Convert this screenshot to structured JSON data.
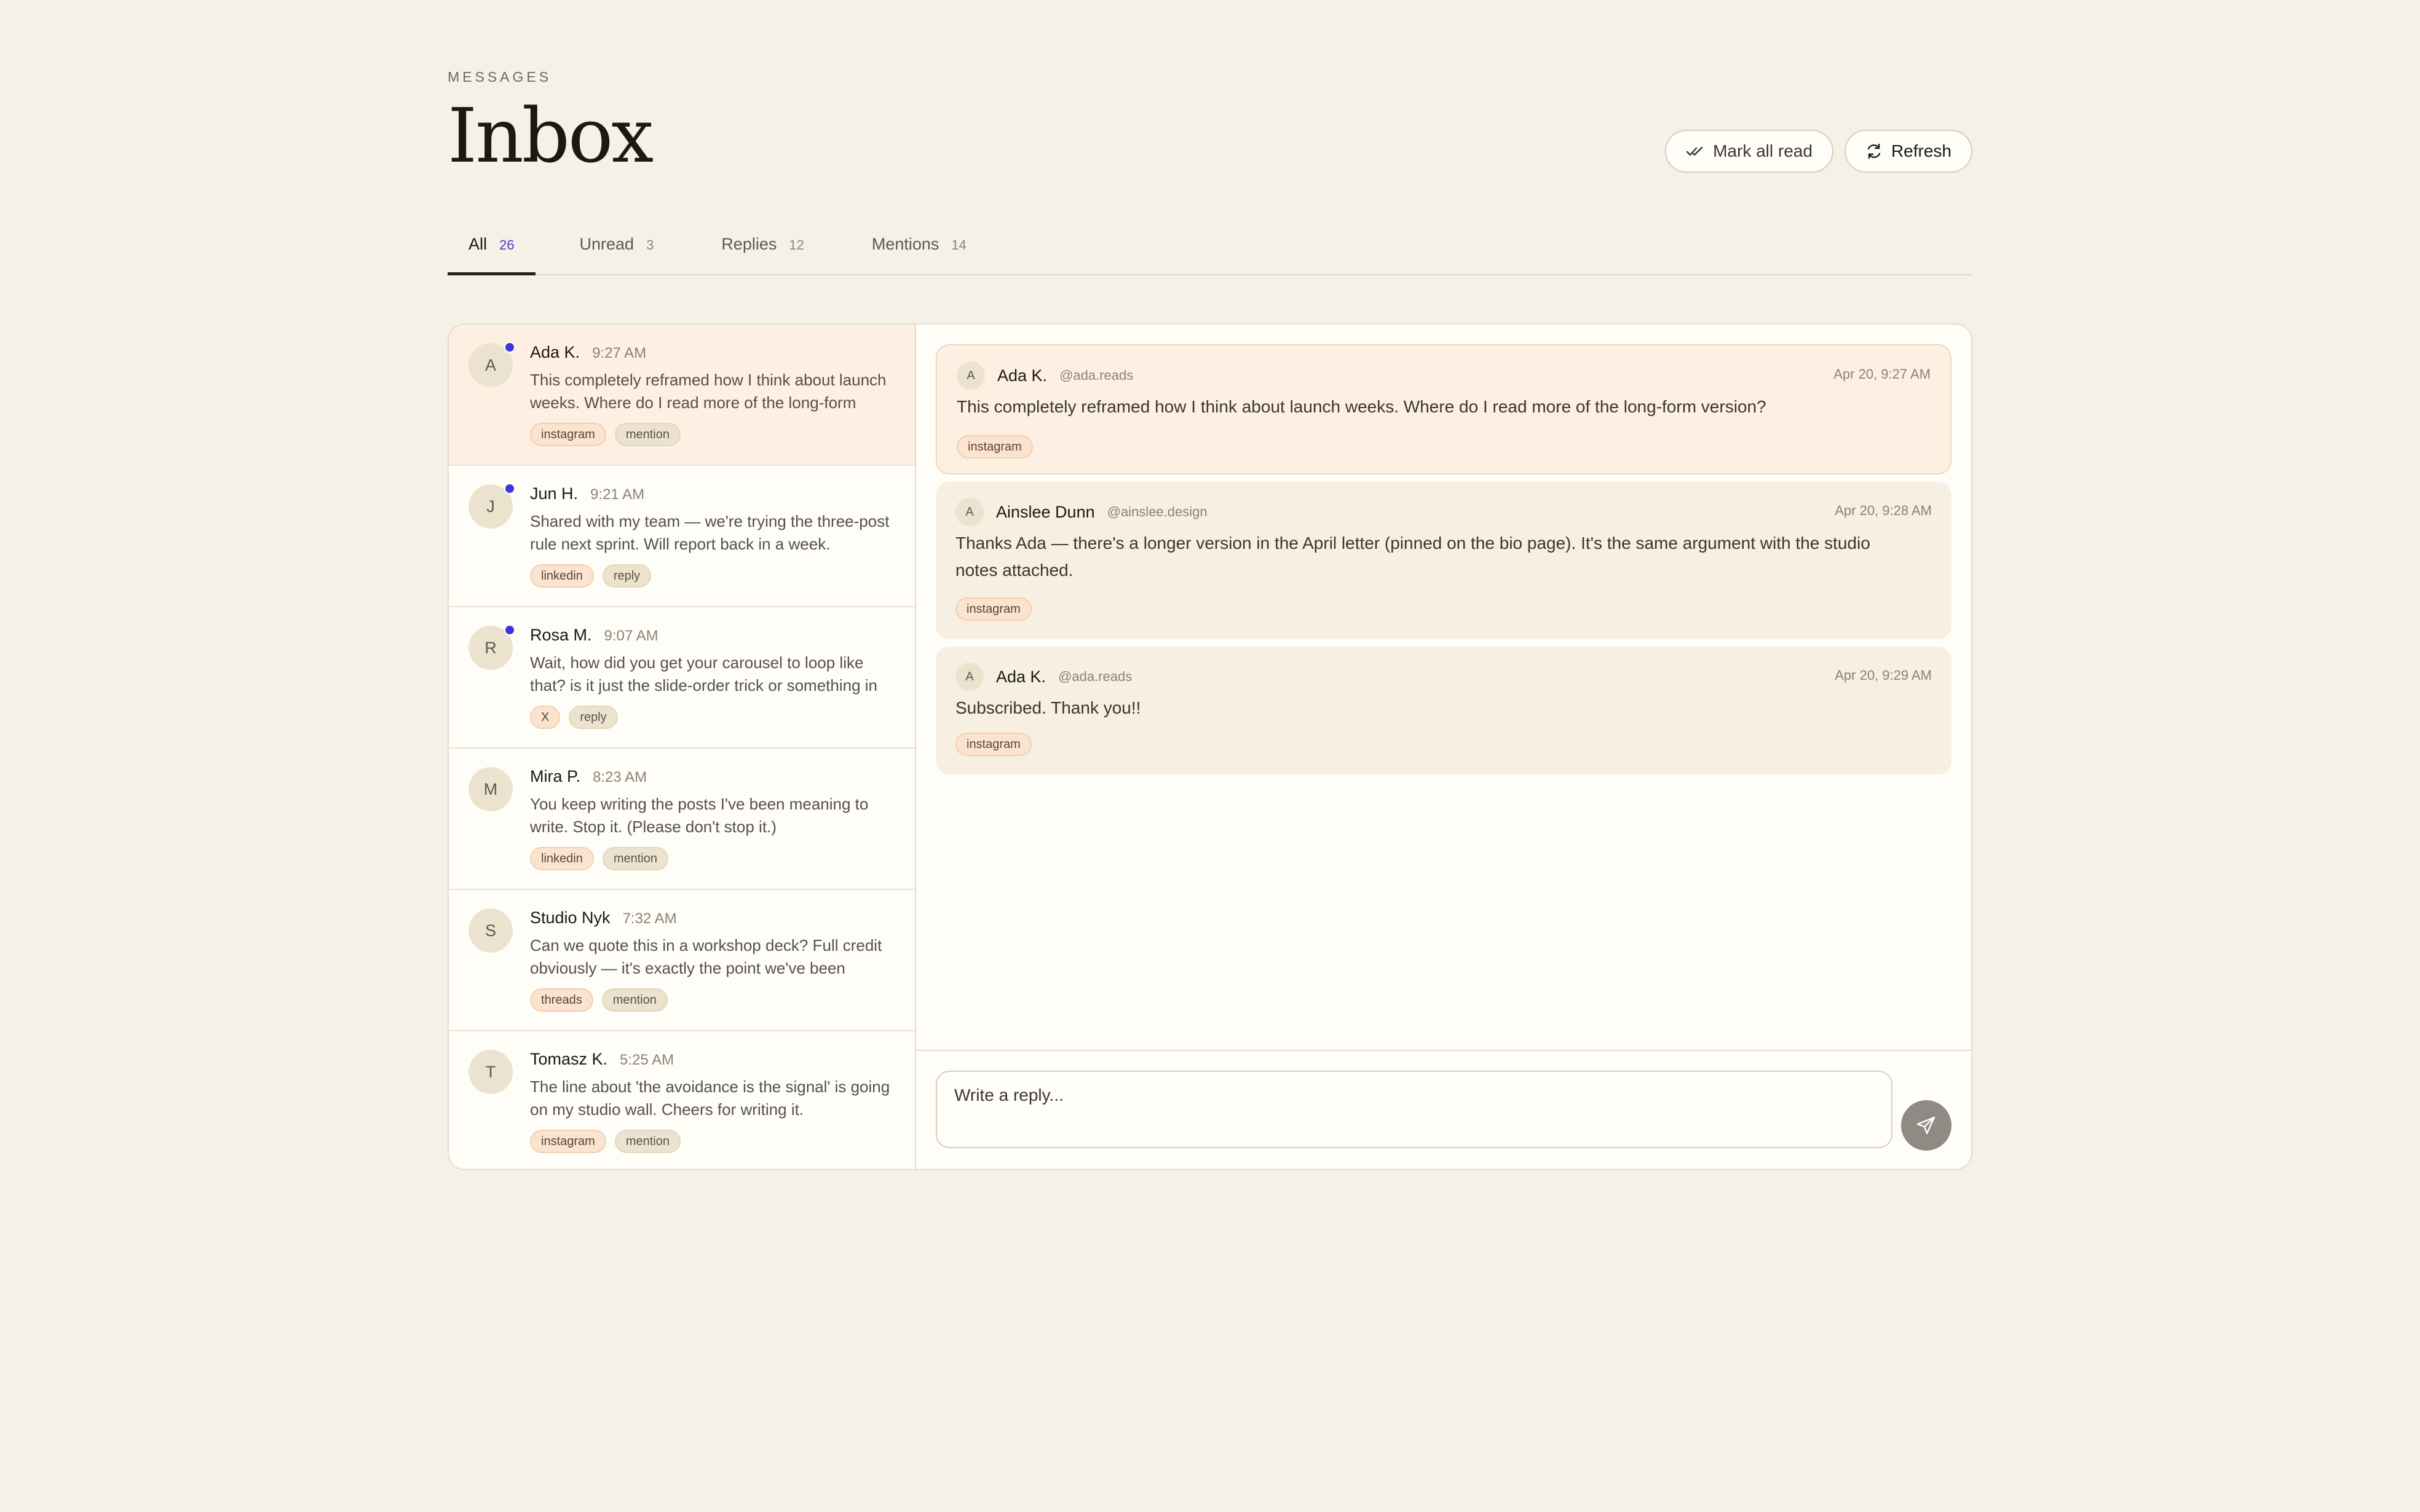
{
  "header": {
    "eyebrow": "MESSAGES",
    "title": "Inbox",
    "mark_all_read": "Mark all read",
    "refresh": "Refresh"
  },
  "tabs": [
    {
      "label": "All",
      "count": "26"
    },
    {
      "label": "Unread",
      "count": "3"
    },
    {
      "label": "Replies",
      "count": "12"
    },
    {
      "label": "Mentions",
      "count": "14"
    }
  ],
  "list": [
    {
      "initial": "A",
      "name": "Ada K.",
      "time": "9:27 AM",
      "snippet": "This completely reframed how I think about launch weeks. Where do I read more of the long-form version?",
      "platform": "instagram",
      "type": "mention",
      "unread": true
    },
    {
      "initial": "J",
      "name": "Jun H.",
      "time": "9:21 AM",
      "snippet": "Shared with my team — we're trying the three-post rule next sprint. Will report back in a week.",
      "platform": "linkedin",
      "type": "reply",
      "unread": true
    },
    {
      "initial": "R",
      "name": "Rosa M.",
      "time": "9:07 AM",
      "snippet": "Wait, how did you get your carousel to loop like that? is it just the slide-order trick or something in the app?",
      "platform": "X",
      "type": "reply",
      "unread": true
    },
    {
      "initial": "M",
      "name": "Mira P.",
      "time": "8:23 AM",
      "snippet": "You keep writing the posts I've been meaning to write. Stop it. (Please don't stop it.)",
      "platform": "linkedin",
      "type": "mention",
      "unread": false
    },
    {
      "initial": "S",
      "name": "Studio Nyk",
      "time": "7:32 AM",
      "snippet": "Can we quote this in a workshop deck? Full credit obviously — it's exactly the point we've been making.",
      "platform": "threads",
      "type": "mention",
      "unread": false
    },
    {
      "initial": "T",
      "name": "Tomasz K.",
      "time": "5:25 AM",
      "snippet": "The line about 'the avoidance is the signal' is going on my studio wall. Cheers for writing it.",
      "platform": "instagram",
      "type": "mention",
      "unread": false
    }
  ],
  "thread": [
    {
      "initial": "A",
      "name": "Ada K.",
      "handle": "@ada.reads",
      "date": "Apr 20, 9:27 AM",
      "body": "This completely reframed how I think about launch weeks. Where do I read more of the long-form version?",
      "tag": "instagram"
    },
    {
      "initial": "A",
      "name": "Ainslee Dunn",
      "handle": "@ainslee.design",
      "date": "Apr 20, 9:28 AM",
      "body": "Thanks Ada — there's a longer version in the April letter (pinned on the bio page). It's the same argument with the studio notes attached.",
      "tag": "instagram"
    },
    {
      "initial": "A",
      "name": "Ada K.",
      "handle": "@ada.reads",
      "date": "Apr 20, 9:29 AM",
      "body": "Subscribed. Thank you!!",
      "tag": "instagram"
    }
  ],
  "composer": {
    "placeholder": "Write a reply..."
  },
  "colors": {
    "accent": "#3b36d9",
    "background": "#f5f1e6",
    "selected_row": "#fdf0e2"
  },
  "icons": {
    "mark_all_read": "double-check-icon",
    "refresh": "refresh-icon",
    "send": "send-icon"
  }
}
